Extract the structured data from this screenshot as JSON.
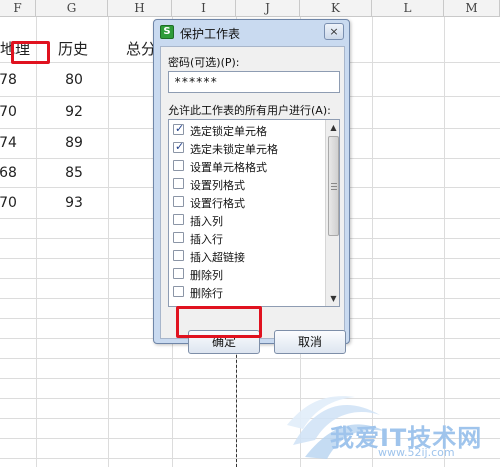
{
  "sheet": {
    "columns": [
      "F",
      "G",
      "H",
      "I",
      "J",
      "K",
      "L",
      "M"
    ],
    "headers": {
      "F": "地理",
      "G": "历史",
      "H": "总分"
    },
    "rows": [
      {
        "F": "78",
        "G": "80"
      },
      {
        "F": "70",
        "G": "92"
      },
      {
        "F": "74",
        "G": "89"
      },
      {
        "F": "68",
        "G": "85"
      },
      {
        "F": "70",
        "G": "93"
      }
    ]
  },
  "dialog": {
    "icon_letter": "S",
    "title": "保护工作表",
    "close_label": "×",
    "password_label": "密码(可选)(P):",
    "password_value": "******",
    "permissions_label": "允许此工作表的所有用户进行(A):",
    "permissions": [
      {
        "label": "选定锁定单元格",
        "checked": true
      },
      {
        "label": "选定未锁定单元格",
        "checked": true
      },
      {
        "label": "设置单元格格式",
        "checked": false
      },
      {
        "label": "设置列格式",
        "checked": false
      },
      {
        "label": "设置行格式",
        "checked": false
      },
      {
        "label": "插入列",
        "checked": false
      },
      {
        "label": "插入行",
        "checked": false
      },
      {
        "label": "插入超链接",
        "checked": false
      },
      {
        "label": "删除列",
        "checked": false
      },
      {
        "label": "删除行",
        "checked": false
      }
    ],
    "ok_label": "确定",
    "cancel_label": "取消"
  },
  "watermark": {
    "text": "我爱IT技术网",
    "url": "www.52ij.com"
  },
  "colors": {
    "highlight": "#e0121f",
    "dialog_frame": "#c9daf0",
    "watermark": "#9fc4ec"
  }
}
